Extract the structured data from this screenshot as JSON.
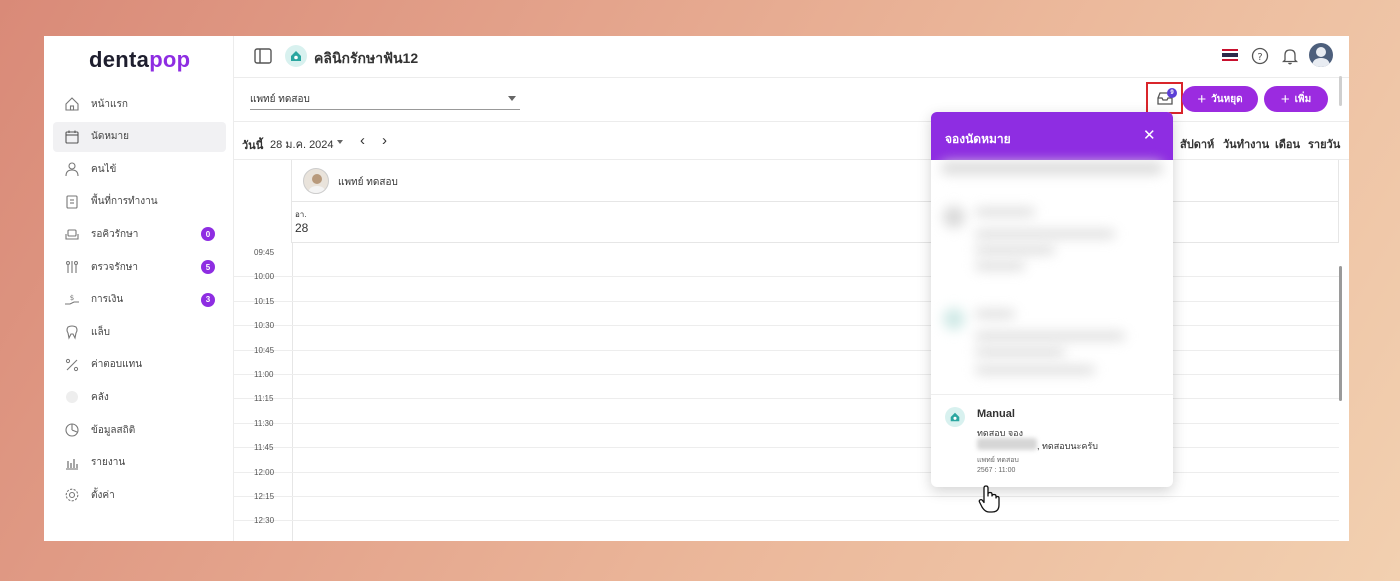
{
  "brand": {
    "logo_main": "denta",
    "logo_accent": "pop",
    "accent_color": "#8e2de2"
  },
  "sidebar": {
    "items": [
      {
        "label": "หน้าแรก",
        "icon": "home-icon"
      },
      {
        "label": "นัดหมาย",
        "icon": "calendar-icon",
        "active": true
      },
      {
        "label": "คนไข้",
        "icon": "user-icon"
      },
      {
        "label": "พื้นที่การทำงาน",
        "icon": "workspace-icon"
      },
      {
        "label": "รอคิวรักษา",
        "icon": "sofa-icon",
        "badge": "0"
      },
      {
        "label": "ตรวจรักษา",
        "icon": "tools-icon",
        "badge": "5"
      },
      {
        "label": "การเงิน",
        "icon": "money-hand-icon",
        "badge": "3"
      },
      {
        "label": "แล็บ",
        "icon": "tooth-icon"
      },
      {
        "label": "ค่าตอบแทน",
        "icon": "percent-icon"
      },
      {
        "label": "คลัง",
        "icon": "warehouse-icon"
      },
      {
        "label": "ข้อมูลสถิติ",
        "icon": "stats-icon"
      },
      {
        "label": "รายงาน",
        "icon": "report-icon"
      },
      {
        "label": "ตั้งค่า",
        "icon": "gear-icon"
      }
    ]
  },
  "header": {
    "clinic_name": "คลินิกรักษาฟัน12"
  },
  "filter": {
    "doctor_selected": "แพทย์ ทดสอบ",
    "inbox_badge": "9",
    "holiday_button": "วันหยุด",
    "add_button": "เพิ่ม"
  },
  "datebar": {
    "today": "วันนี้",
    "date": "28 ม.ค. 2024",
    "views": [
      "สัปดาห์",
      "วันทำงาน",
      "เดือน",
      "รายวัน"
    ]
  },
  "calendar": {
    "doctor_name": "แพทย์ ทดสอบ",
    "day_abbr": "อา.",
    "day_num": "28",
    "times": [
      "09:45",
      "10:00",
      "10:15",
      "10:30",
      "10:45",
      "11:00",
      "11:15",
      "11:30",
      "11:45",
      "12:00",
      "12:15",
      "12:30"
    ]
  },
  "popup": {
    "title": "จองนัดหมาย",
    "close": "✕",
    "item": {
      "source": "Manual",
      "patient": "ทดสอบ จอง",
      "note": ", ทดสอบนะครับ",
      "doctor": "แพทย์ ทดสอบ",
      "time": "2567 : 11:00"
    }
  }
}
